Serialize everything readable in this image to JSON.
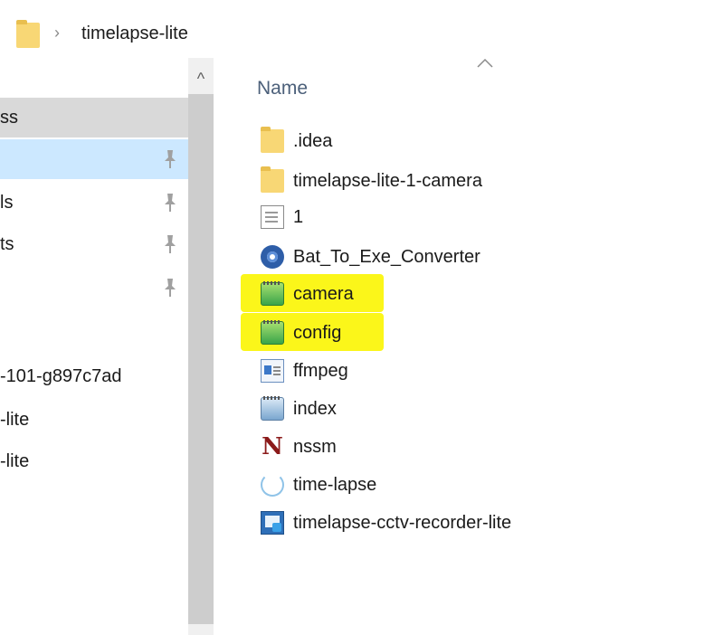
{
  "address_bar": {
    "folder_icon": "folder-icon",
    "separator": "›",
    "path": "timelapse-lite"
  },
  "nav_pane": {
    "items": [
      {
        "label": "ss",
        "pinned": false
      },
      {
        "label": "",
        "pinned": true
      },
      {
        "label": "ls",
        "pinned": true
      },
      {
        "label": "ts",
        "pinned": true
      },
      {
        "label": "",
        "pinned": true
      },
      {
        "label": "-101-g897c7ad",
        "pinned": false
      },
      {
        "label": "-lite",
        "pinned": false
      },
      {
        "label": "-lite",
        "pinned": false
      }
    ],
    "scroll_up_glyph": "^"
  },
  "file_list": {
    "column_header": "Name",
    "sort_glyph": "^",
    "items": [
      {
        "name": ".idea",
        "icon": "folder-icon",
        "highlighted": false
      },
      {
        "name": "timelapse-lite-1-camera",
        "icon": "folder-icon",
        "highlighted": false
      },
      {
        "name": "1",
        "icon": "text-document-icon",
        "highlighted": false
      },
      {
        "name": "Bat_To_Exe_Converter",
        "icon": "gear-app-icon",
        "highlighted": false
      },
      {
        "name": "camera",
        "icon": "notepad-green-icon",
        "highlighted": true
      },
      {
        "name": "config",
        "icon": "notepad-green-icon",
        "highlighted": true
      },
      {
        "name": "ffmpeg",
        "icon": "executable-icon",
        "highlighted": false
      },
      {
        "name": "index",
        "icon": "notepad-icon",
        "highlighted": false
      },
      {
        "name": "nssm",
        "icon": "nssm-n-icon",
        "highlighted": false
      },
      {
        "name": "time-lapse",
        "icon": "timer-icon",
        "highlighted": false
      },
      {
        "name": "timelapse-cctv-recorder-lite",
        "icon": "media-app-icon",
        "highlighted": false
      }
    ]
  },
  "colors": {
    "highlight": "#fbf61a",
    "nav_selected_gray": "#d9d9d9",
    "nav_selected_blue": "#cce8ff",
    "header_text": "#4c607a"
  }
}
